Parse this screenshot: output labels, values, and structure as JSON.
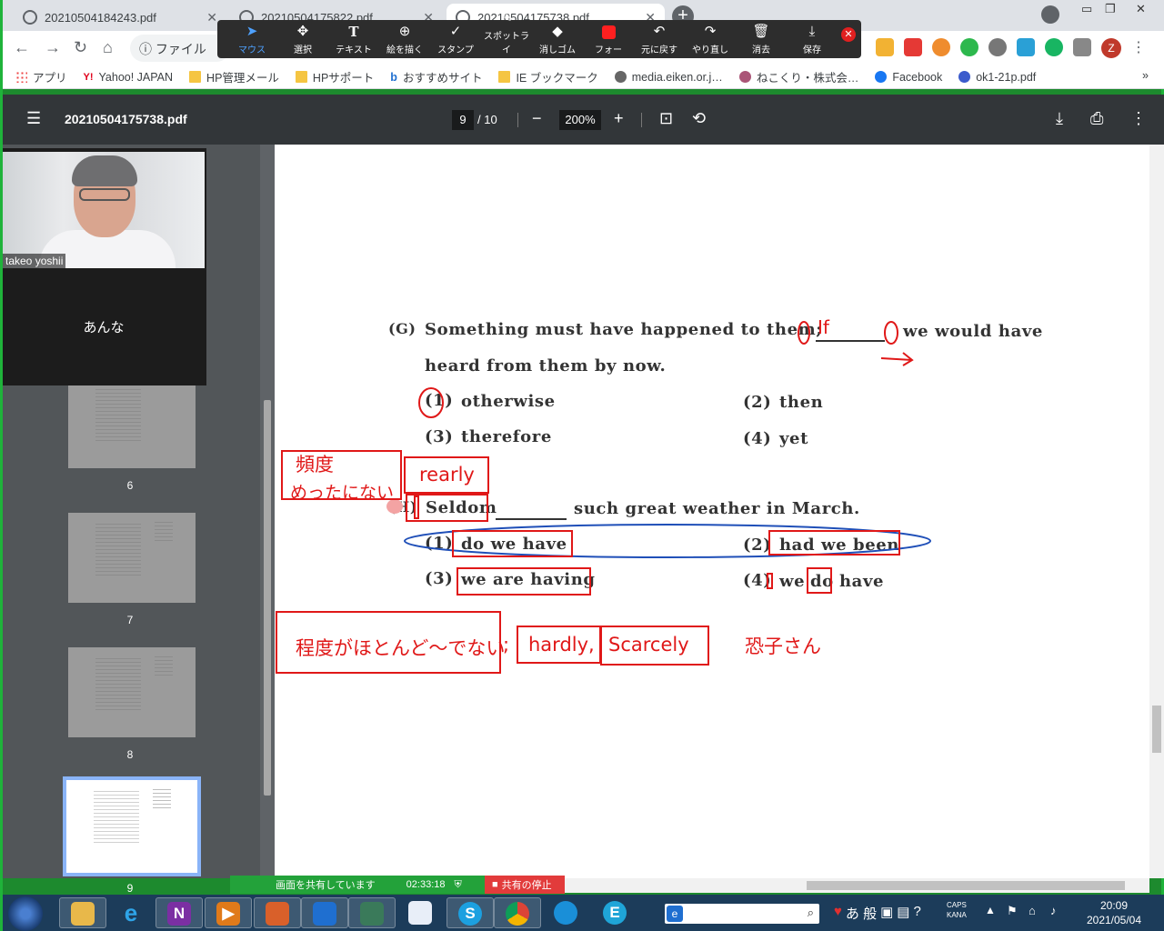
{
  "browser": {
    "tabs": [
      {
        "title": "20210504184243.pdf"
      },
      {
        "title": "20210504175822.pdf"
      },
      {
        "title": "20210504175738.pdf"
      }
    ],
    "address_text": "ファイル",
    "profile_initial": "Z"
  },
  "annotate_toolbar": {
    "tools": [
      {
        "label": "マウス",
        "icon": "pointer-icon"
      },
      {
        "label": "選択",
        "icon": "move-icon"
      },
      {
        "label": "テキスト",
        "icon": "text-icon"
      },
      {
        "label": "絵を描く",
        "icon": "draw-icon"
      },
      {
        "label": "スタンプ",
        "icon": "stamp-icon"
      },
      {
        "label": "スポットライ",
        "icon": "spotlight-icon"
      },
      {
        "label": "消しゴム",
        "icon": "eraser-icon"
      },
      {
        "label": "フォー",
        "icon": "format-color-icon"
      },
      {
        "label": "元に戻す",
        "icon": "undo-icon"
      },
      {
        "label": "やり直し",
        "icon": "redo-icon"
      },
      {
        "label": "消去",
        "icon": "trash-icon"
      },
      {
        "label": "保存",
        "icon": "save-icon"
      }
    ],
    "active_color": "#ff2020"
  },
  "bookmarks": [
    {
      "label": "アプリ",
      "icon": "apps-grid-icon"
    },
    {
      "label": "Yahoo! JAPAN",
      "icon": "yahoo-icon"
    },
    {
      "label": "HP管理メール",
      "icon": "folder-icon"
    },
    {
      "label": "HPサポート",
      "icon": "folder-icon"
    },
    {
      "label": "おすすめサイト",
      "icon": "bing-icon"
    },
    {
      "label": "IE ブックマーク",
      "icon": "folder-icon"
    },
    {
      "label": "media.eiken.or.j…",
      "icon": "globe-icon"
    },
    {
      "label": "ねこくり・株式会…",
      "icon": "site-icon"
    },
    {
      "label": "Facebook",
      "icon": "facebook-icon"
    },
    {
      "label": "ok1-21p.pdf",
      "icon": "pdf-site-icon"
    }
  ],
  "pdf": {
    "filename": "20210504175738.pdf",
    "current_page": "9",
    "total_pages": "/ 10",
    "zoom": "200%",
    "thumbnails": [
      {
        "num": "6"
      },
      {
        "num": "7"
      },
      {
        "num": "8"
      },
      {
        "num": "9"
      }
    ]
  },
  "video": {
    "participant_label": "takeo yoshii",
    "other_name": "あんな"
  },
  "document": {
    "qG": {
      "marker": "(G)",
      "line1": "Something must have happened to them;",
      "line1b": "we would have",
      "line2": "heard from them by now.",
      "options": [
        "(1)",
        "otherwise",
        "(2)",
        "then",
        "(3)",
        "therefore",
        "(4)",
        "yet"
      ]
    },
    "qH": {
      "marker": "(H)",
      "lead": "Seldom",
      "rest": "such great weather in March.",
      "options": [
        "(1)",
        "do we have",
        "(2)",
        "had we been",
        "(3)",
        "we are having",
        "(4)",
        "we",
        "do",
        "have"
      ]
    },
    "handwriting": {
      "if_mark": "If",
      "freq_line1": "頻度",
      "freq_line2": "めったにない",
      "rearly": "rearly",
      "degree": "程度がほとんど～でない",
      "semicolon": ";",
      "hardly": "hardly,",
      "scarcely": "Scarcely",
      "kyoko": "恐子さん"
    }
  },
  "share_bar": {
    "status": "画面を共有しています",
    "timer": "02:33:18",
    "stop_label": "共有の停止"
  },
  "taskbar": {
    "ime_text": "あ 般",
    "caps": "CAPS",
    "kana": "KANA",
    "time": "20:09",
    "date": "2021/05/04"
  }
}
